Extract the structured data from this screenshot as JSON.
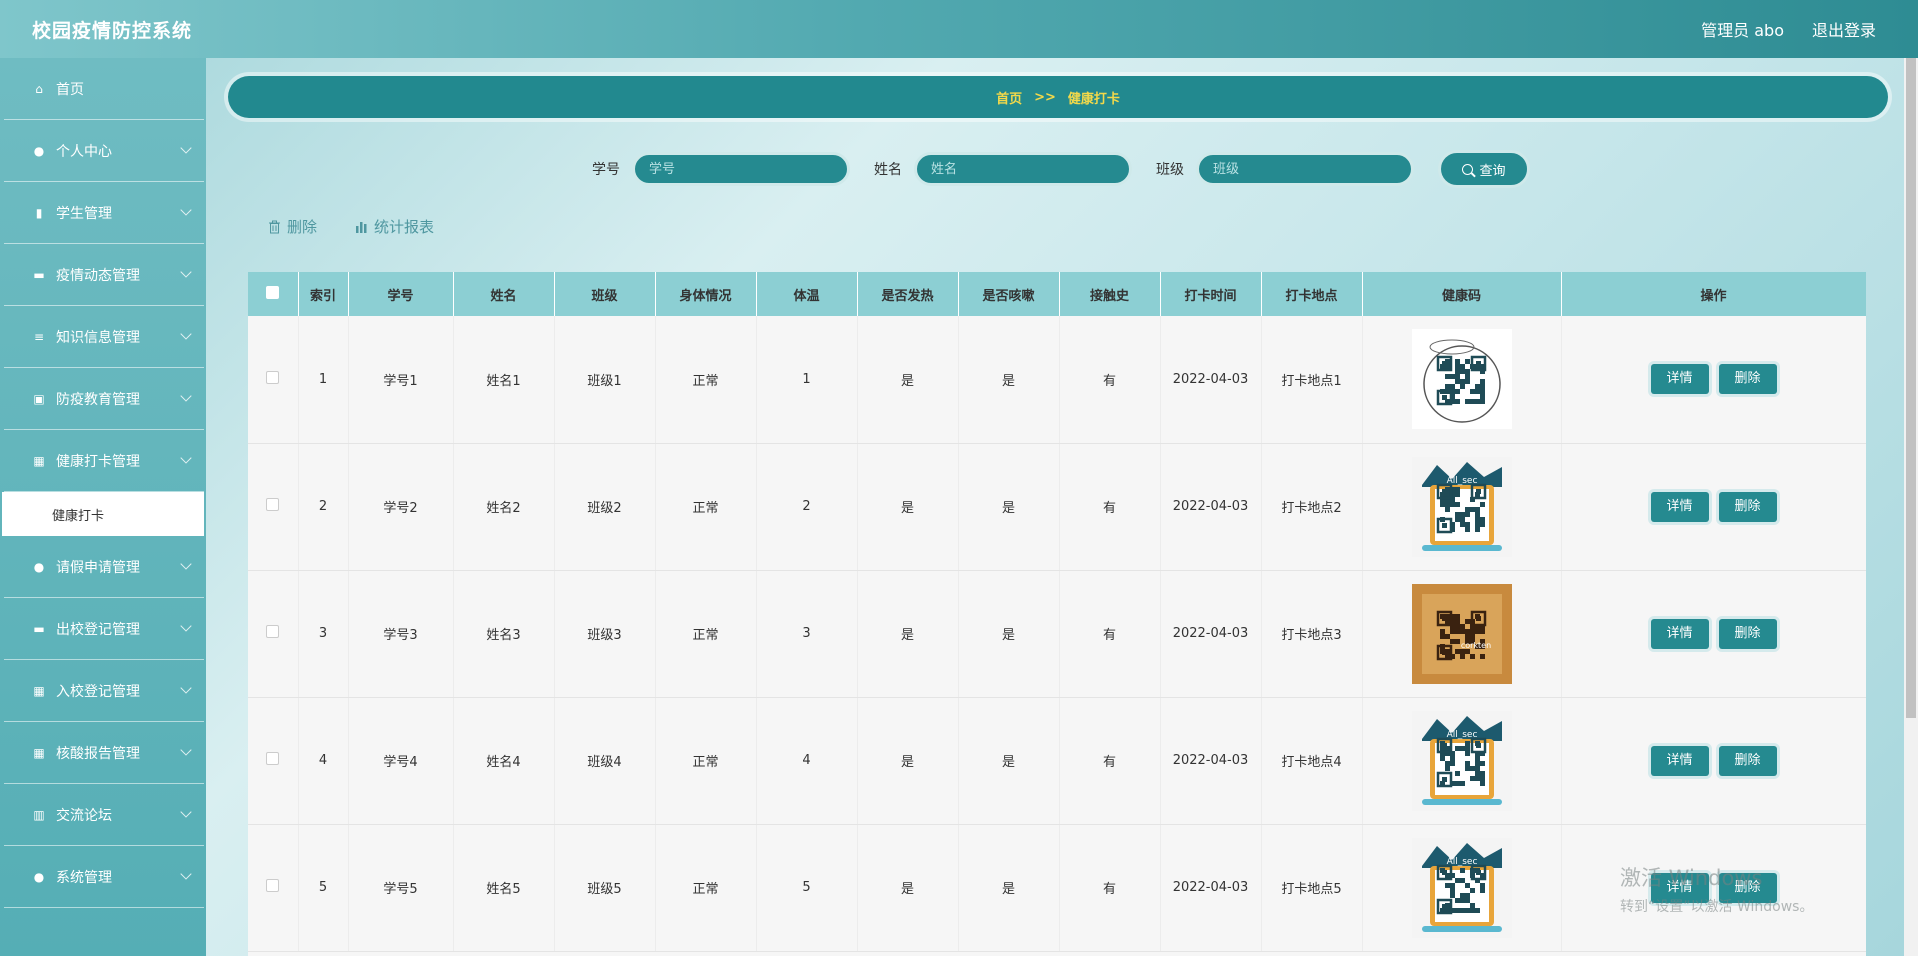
{
  "header": {
    "title": "校园疫情防控系统",
    "user_label": "管理员 abo",
    "logout_label": "退出登录"
  },
  "sidebar": {
    "items": [
      {
        "label": "首页",
        "icon": "home-icon",
        "glyph": "⌂",
        "chevron": false
      },
      {
        "label": "个人中心",
        "icon": "user-icon",
        "glyph": "●",
        "chevron": true
      },
      {
        "label": "学生管理",
        "icon": "thumb-icon",
        "glyph": "▮",
        "chevron": true
      },
      {
        "label": "疫情动态管理",
        "icon": "monitor-icon",
        "glyph": "▬",
        "chevron": true
      },
      {
        "label": "知识信息管理",
        "icon": "list-icon",
        "glyph": "≡",
        "chevron": true
      },
      {
        "label": "防疫教育管理",
        "icon": "image-icon",
        "glyph": "▣",
        "chevron": true
      },
      {
        "label": "健康打卡管理",
        "icon": "grid-icon",
        "glyph": "▦",
        "chevron": true
      }
    ],
    "submenu": {
      "label": "健康打卡"
    },
    "items_after": [
      {
        "label": "请假申请管理",
        "icon": "user-icon",
        "glyph": "●",
        "chevron": true
      },
      {
        "label": "出校登记管理",
        "icon": "chat-icon",
        "glyph": "▬",
        "chevron": true
      },
      {
        "label": "入校登记管理",
        "icon": "grid-icon",
        "glyph": "▦",
        "chevron": true
      },
      {
        "label": "核酸报告管理",
        "icon": "grid-icon",
        "glyph": "▦",
        "chevron": true
      },
      {
        "label": "交流论坛",
        "icon": "chart-icon",
        "glyph": "▥",
        "chevron": true
      },
      {
        "label": "系统管理",
        "icon": "location-icon",
        "glyph": "●",
        "chevron": true
      }
    ]
  },
  "breadcrumb": {
    "home": "首页",
    "separator": ">>",
    "current": "健康打卡"
  },
  "search": {
    "fields": [
      {
        "label": "学号",
        "placeholder": "学号"
      },
      {
        "label": "姓名",
        "placeholder": "姓名"
      },
      {
        "label": "班级",
        "placeholder": "班级"
      }
    ],
    "button_label": "查询"
  },
  "actions": {
    "delete_label": "删除",
    "report_label": "统计报表"
  },
  "table": {
    "columns": [
      "索引",
      "学号",
      "姓名",
      "班级",
      "身体情况",
      "体温",
      "是否发热",
      "是否咳嗽",
      "接触史",
      "打卡时间",
      "打卡地点",
      "健康码",
      "操作"
    ],
    "rows": [
      {
        "index": "1",
        "sid": "学号1",
        "name": "姓名1",
        "cls": "班级1",
        "body": "正常",
        "temp": "1",
        "fever": "是",
        "cough": "是",
        "contact": "有",
        "time": "2022-04-03",
        "place": "打卡地点1",
        "qr": "qr-circle"
      },
      {
        "index": "2",
        "sid": "学号2",
        "name": "姓名2",
        "cls": "班级2",
        "body": "正常",
        "temp": "2",
        "fever": "是",
        "cough": "是",
        "contact": "有",
        "time": "2022-04-03",
        "place": "打卡地点2",
        "qr": "qr-allsec"
      },
      {
        "index": "3",
        "sid": "学号3",
        "name": "姓名3",
        "cls": "班级3",
        "body": "正常",
        "temp": "3",
        "fever": "是",
        "cough": "是",
        "contact": "有",
        "time": "2022-04-03",
        "place": "打卡地点3",
        "qr": "qr-cork"
      },
      {
        "index": "4",
        "sid": "学号4",
        "name": "姓名4",
        "cls": "班级4",
        "body": "正常",
        "temp": "4",
        "fever": "是",
        "cough": "是",
        "contact": "有",
        "time": "2022-04-03",
        "place": "打卡地点4",
        "qr": "qr-allsec"
      },
      {
        "index": "5",
        "sid": "学号5",
        "name": "姓名5",
        "cls": "班级5",
        "body": "正常",
        "temp": "5",
        "fever": "是",
        "cough": "是",
        "contact": "有",
        "time": "2022-04-03",
        "place": "打卡地点5",
        "qr": "qr-allsec"
      }
    ],
    "detail_label": "详情",
    "row_delete_label": "删除"
  },
  "watermark": {
    "line1": "激活 Windows",
    "line2": "转到“设置”以激活 Windows。"
  },
  "colors": {
    "accent": "#258a90",
    "breadcrumb_text": "#f3d94a",
    "header_row": "#8ccfd3"
  }
}
